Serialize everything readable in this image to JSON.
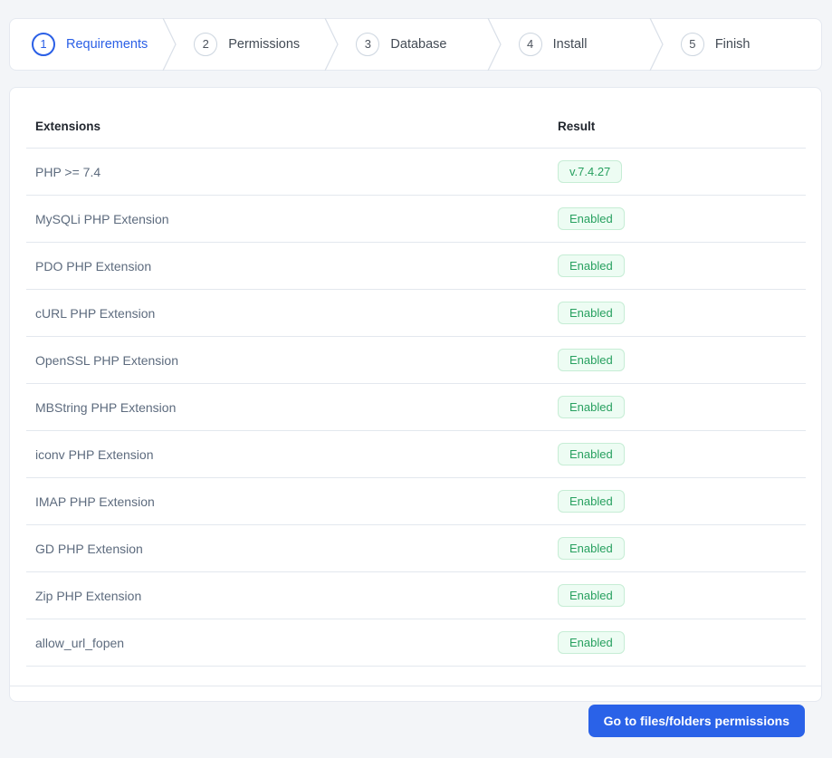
{
  "colors": {
    "accent": "#2a5fe6",
    "button": "#2a62e8",
    "success_text": "#27a05f",
    "success_bg": "#edfcf3",
    "success_border": "#c6edd5"
  },
  "stepper": {
    "steps": [
      {
        "number": "1",
        "label": "Requirements",
        "active": true
      },
      {
        "number": "2",
        "label": "Permissions",
        "active": false
      },
      {
        "number": "3",
        "label": "Database",
        "active": false
      },
      {
        "number": "4",
        "label": "Install",
        "active": false
      },
      {
        "number": "5",
        "label": "Finish",
        "active": false
      }
    ]
  },
  "table": {
    "headers": {
      "extensions": "Extensions",
      "result": "Result"
    },
    "rows": [
      {
        "name": "PHP >= 7.4",
        "result": "v.7.4.27"
      },
      {
        "name": "MySQLi PHP Extension",
        "result": "Enabled"
      },
      {
        "name": "PDO PHP Extension",
        "result": "Enabled"
      },
      {
        "name": "cURL PHP Extension",
        "result": "Enabled"
      },
      {
        "name": "OpenSSL PHP Extension",
        "result": "Enabled"
      },
      {
        "name": "MBString PHP Extension",
        "result": "Enabled"
      },
      {
        "name": "iconv PHP Extension",
        "result": "Enabled"
      },
      {
        "name": "IMAP PHP Extension",
        "result": "Enabled"
      },
      {
        "name": "GD PHP Extension",
        "result": "Enabled"
      },
      {
        "name": "Zip PHP Extension",
        "result": "Enabled"
      },
      {
        "name": "allow_url_fopen",
        "result": "Enabled"
      }
    ]
  },
  "footer": {
    "button_label": "Go to files/folders permissions"
  }
}
